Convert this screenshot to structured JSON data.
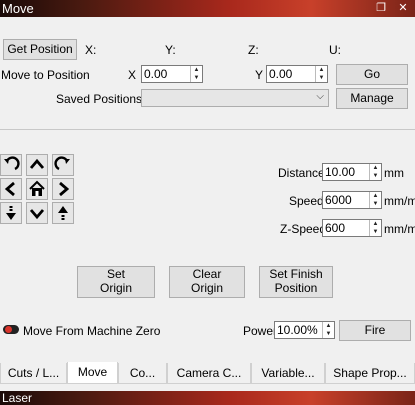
{
  "window": {
    "title": "Move",
    "float_icon": "restore-icon",
    "close_icon": "close-icon"
  },
  "position": {
    "get_button": "Get Position",
    "x_label": "X:",
    "y_label": "Y:",
    "z_label": "Z:",
    "u_label": "U:",
    "move_to_label": "Move to Position",
    "x_field_label": "X",
    "x_value": "0.00",
    "y_field_label": "Y",
    "y_value": "0.00",
    "go_button": "Go",
    "saved_label": "Saved Positions:",
    "saved_value": "",
    "manage_button": "Manage"
  },
  "jog": {
    "distance_label": "Distance",
    "distance_value": "10.00",
    "distance_unit": "mm",
    "speed_label": "Speed",
    "speed_value": "6000",
    "speed_unit": "mm/m",
    "zspeed_label": "Z-Speed",
    "zspeed_value": "600",
    "zspeed_unit": "mm/m"
  },
  "actions": {
    "set_origin": "Set\nOrigin",
    "clear_origin": "Clear\nOrigin",
    "set_finish": "Set Finish\nPosition"
  },
  "laser": {
    "move_from_zero_label": "Move From Machine Zero",
    "move_from_zero_on": false,
    "power_label": "Power",
    "power_value": "10.00%",
    "fire_button": "Fire"
  },
  "tabs": [
    {
      "label": "Cuts / L..."
    },
    {
      "label": "Move",
      "active": true
    },
    {
      "label": "Co..."
    },
    {
      "label": "Camera C..."
    },
    {
      "label": "Variable..."
    },
    {
      "label": "Shape Prop..."
    }
  ],
  "bottom_window": {
    "title": "Laser"
  },
  "colors": {
    "titlebar_accent": "#c8402a",
    "toggle_knob": "#d9342b"
  }
}
